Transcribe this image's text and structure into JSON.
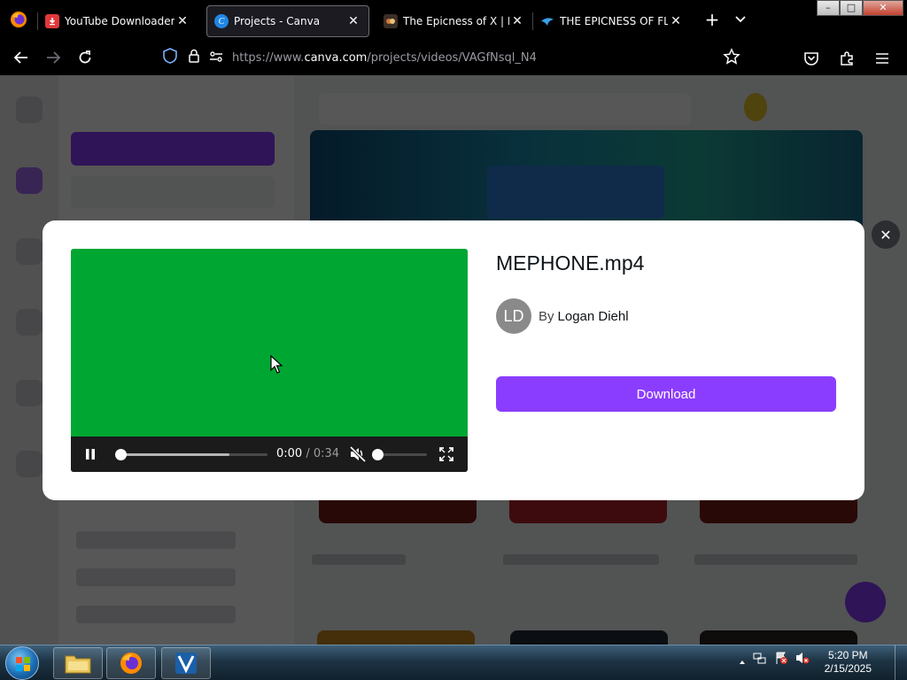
{
  "browser": {
    "tabs": [
      {
        "title": "YouTube Downloader - |",
        "icon": "youtube-downloader-icon",
        "active": false
      },
      {
        "title": "Projects - Canva",
        "icon": "canva-icon",
        "active": true
      },
      {
        "title": "The Epicness of X | Logo",
        "icon": "fandom-icon",
        "active": false
      },
      {
        "title": "THE EPICNESS OF FLIPPI",
        "icon": "bird-icon",
        "active": false
      }
    ],
    "url_prefix": "https://www.",
    "url_host": "canva.com",
    "url_path": "/projects/videos/VAGfNsql_N4",
    "window_controls": {
      "minimize": "–",
      "maximize": "□",
      "close": "✕"
    }
  },
  "modal": {
    "file_name": "MEPHONE.mp4",
    "author_initials": "LD",
    "by_label": "By",
    "author_name": "Logan Diehl",
    "download_label": "Download",
    "close_glyph": "✕"
  },
  "player": {
    "current_time": "0:00",
    "separator": "/",
    "duration": "0:34",
    "progress_fraction": 0,
    "buffered_fraction": 0.74,
    "volume_fraction": 0,
    "muted": true,
    "background_color": "#00a632"
  },
  "taskbar": {
    "time": "5:20 PM",
    "date": "2/15/2025"
  },
  "colors": {
    "accent": "#8b3dff",
    "video_green": "#00a632",
    "modal_bg": "#ffffff"
  }
}
